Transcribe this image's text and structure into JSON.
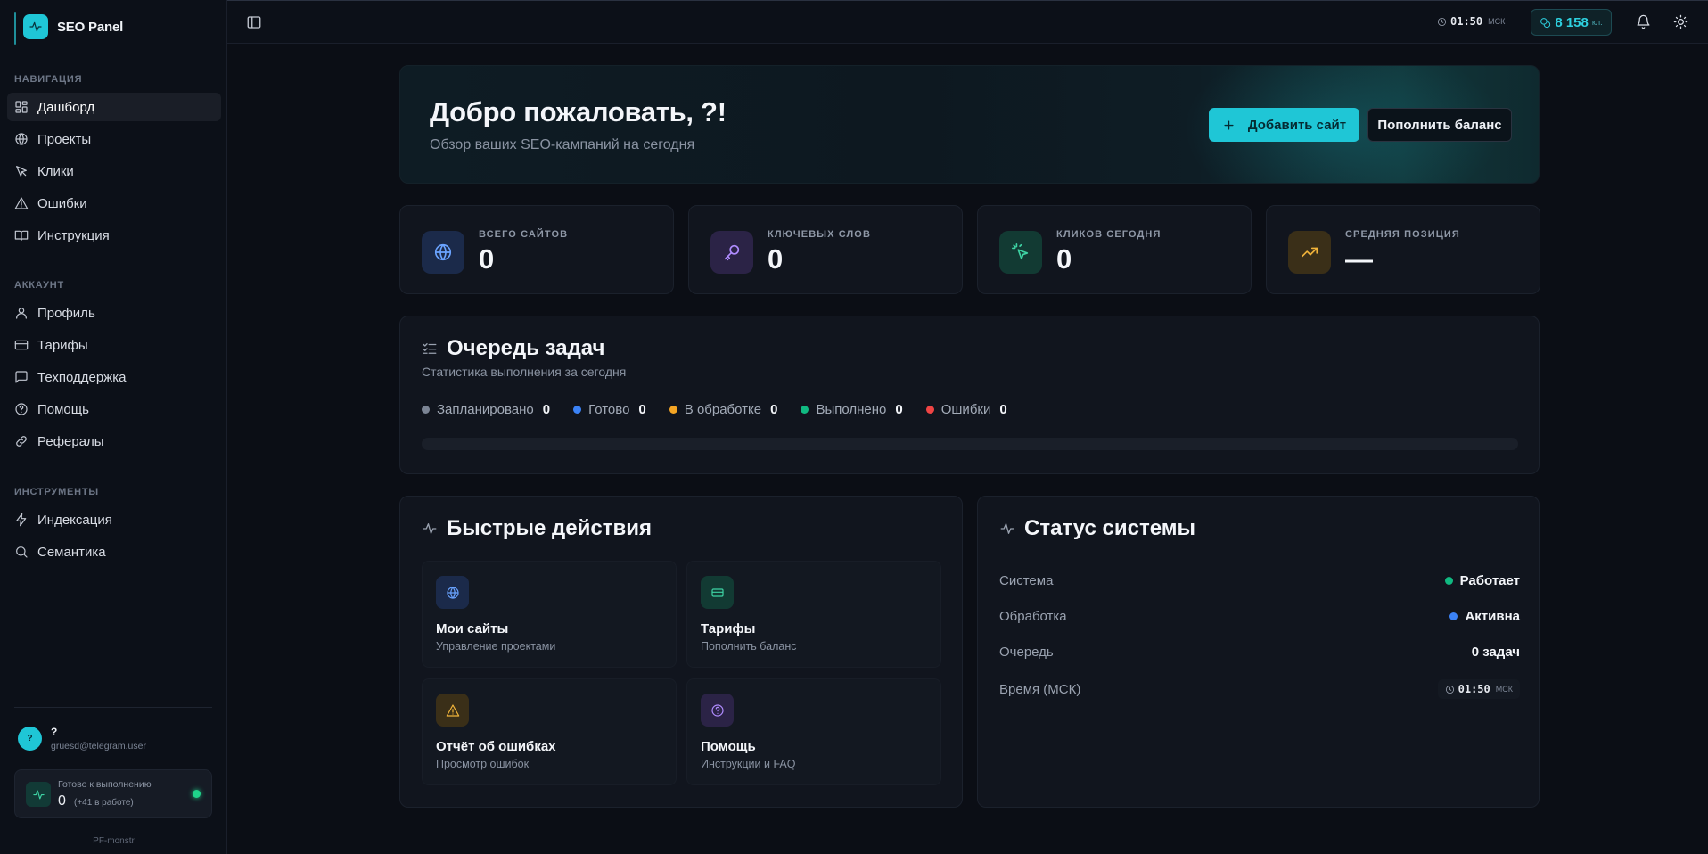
{
  "app": {
    "name": "SEO Panel"
  },
  "sidebar": {
    "sections": [
      {
        "heading": "НАВИГАЦИЯ",
        "items": [
          {
            "label": "Дашборд",
            "icon": "dashboard-icon",
            "active": true
          },
          {
            "label": "Проекты",
            "icon": "globe-icon"
          },
          {
            "label": "Клики",
            "icon": "cursor-icon"
          },
          {
            "label": "Ошибки",
            "icon": "warning-icon"
          },
          {
            "label": "Инструкция",
            "icon": "book-icon"
          }
        ]
      },
      {
        "heading": "АККАУНТ",
        "items": [
          {
            "label": "Профиль",
            "icon": "user-icon"
          },
          {
            "label": "Тарифы",
            "icon": "card-icon"
          },
          {
            "label": "Техподдержка",
            "icon": "chat-icon"
          },
          {
            "label": "Помощь",
            "icon": "help-icon"
          },
          {
            "label": "Рефералы",
            "icon": "link-icon"
          }
        ]
      },
      {
        "heading": "ИНСТРУМЕНТЫ",
        "items": [
          {
            "label": "Индексация",
            "icon": "bolt-icon"
          },
          {
            "label": "Семантика",
            "icon": "search-icon"
          }
        ]
      }
    ],
    "user": {
      "avatar": "?",
      "name": "?",
      "email": "gruesd@telegram.user"
    },
    "queue": {
      "label": "Готово к выполнению",
      "count": "0",
      "extra": "(+41 в работе)",
      "status_color": "#1fd38a"
    },
    "footer": "PF-monstr"
  },
  "topbar": {
    "time": "01:50",
    "tz": "МСК",
    "credits": "8 158",
    "credits_unit": "кл."
  },
  "hero": {
    "title": "Добро пожаловать, ?!",
    "subtitle": "Обзор ваших SEO-кампаний на сегодня",
    "add_site": "Добавить сайт",
    "top_up": "Пополнить баланс"
  },
  "stats": [
    {
      "label": "ВСЕГО САЙТОВ",
      "value": "0",
      "icon": "globe-icon",
      "bg": "#1b2a4a",
      "fg": "#6aa3ff"
    },
    {
      "label": "КЛЮЧЕВЫХ СЛОВ",
      "value": "0",
      "icon": "key-icon",
      "bg": "#2b2346",
      "fg": "#b08cff"
    },
    {
      "label": "КЛИКОВ СЕГОДНЯ",
      "value": "0",
      "icon": "click-icon",
      "bg": "#123a33",
      "fg": "#3ed3a4"
    },
    {
      "label": "СРЕДНЯЯ ПОЗИЦИЯ",
      "value": "—",
      "icon": "trend-up-icon",
      "bg": "#3a2f18",
      "fg": "#f1b43a"
    }
  ],
  "queue_card": {
    "title": "Очередь задач",
    "subtitle": "Статистика выполнения за сегодня",
    "legend": [
      {
        "label": "Запланировано",
        "value": "0",
        "color": "#7b8494"
      },
      {
        "label": "Готово",
        "value": "0",
        "color": "#3b82f6"
      },
      {
        "label": "В обработке",
        "value": "0",
        "color": "#f5a524"
      },
      {
        "label": "Выполнено",
        "value": "0",
        "color": "#10b981"
      },
      {
        "label": "Ошибки",
        "value": "0",
        "color": "#ef4444"
      }
    ],
    "progress": 0
  },
  "quick_actions": {
    "title": "Быстрые действия",
    "tiles": [
      {
        "title": "Мои сайты",
        "subtitle": "Управление проектами",
        "icon": "globe-icon",
        "bg": "#1b2a4a",
        "fg": "#6aa3ff"
      },
      {
        "title": "Тарифы",
        "subtitle": "Пополнить баланс",
        "icon": "card-icon",
        "bg": "#123a33",
        "fg": "#3ed3a4"
      },
      {
        "title": "Отчёт об ошибках",
        "subtitle": "Просмотр ошибок",
        "icon": "warning-icon",
        "bg": "#3a2f18",
        "fg": "#f1b43a"
      },
      {
        "title": "Помощь",
        "subtitle": "Инструкции и FAQ",
        "icon": "help-icon",
        "bg": "#2b2346",
        "fg": "#b08cff"
      }
    ]
  },
  "system_status": {
    "title": "Статус системы",
    "rows": [
      {
        "key": "Система",
        "value": "Работает",
        "dot": "#10b981"
      },
      {
        "key": "Обработка",
        "value": "Активна",
        "dot": "#3b82f6"
      },
      {
        "key": "Очередь",
        "value": "0 задач"
      },
      {
        "key": "Время (МСК)",
        "time": "01:50",
        "tz": "МСК"
      }
    ]
  }
}
